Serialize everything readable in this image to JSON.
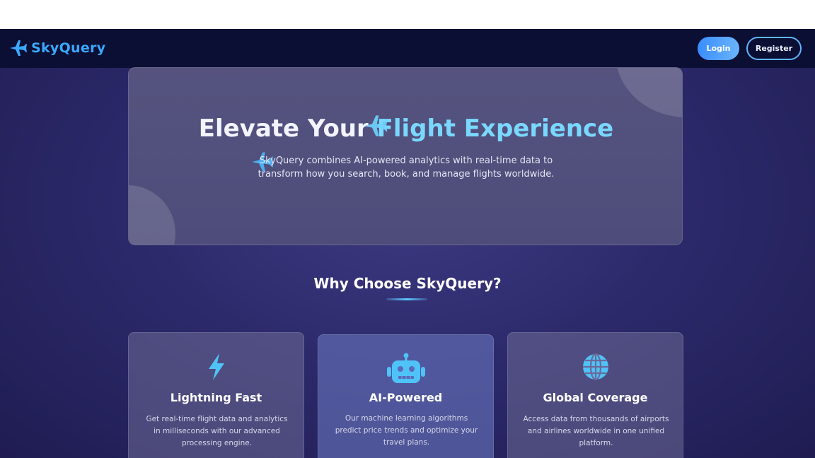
{
  "brand": {
    "name": "SkyQuery",
    "icon": "airplane-icon"
  },
  "nav": {
    "login_label": "Login",
    "register_label": "Register"
  },
  "hero": {
    "title_part1": "Elevate Your ",
    "title_part2": "Flight Experience",
    "subtitle": "SkyQuery combines AI-powered analytics with real-time data to transform how you search, book, and manage flights worldwide."
  },
  "features": {
    "title": "Why Choose SkyQuery?",
    "cards": [
      {
        "icon": "lightning-icon",
        "title": "Lightning Fast",
        "description": "Get real-time flight data and analytics in milliseconds with our advanced processing engine."
      },
      {
        "icon": "robot-icon",
        "title": "AI-Powered",
        "description": "Our machine learning algorithms predict price trends and optimize your travel plans."
      },
      {
        "icon": "globe-icon",
        "title": "Global Coverage",
        "description": "Access data from thousands of airports and airlines worldwide in one unified platform."
      }
    ]
  },
  "colors": {
    "accent": "#3aa9ff",
    "navbar": "#0b0f33",
    "highlight": "#7ad8ff"
  }
}
